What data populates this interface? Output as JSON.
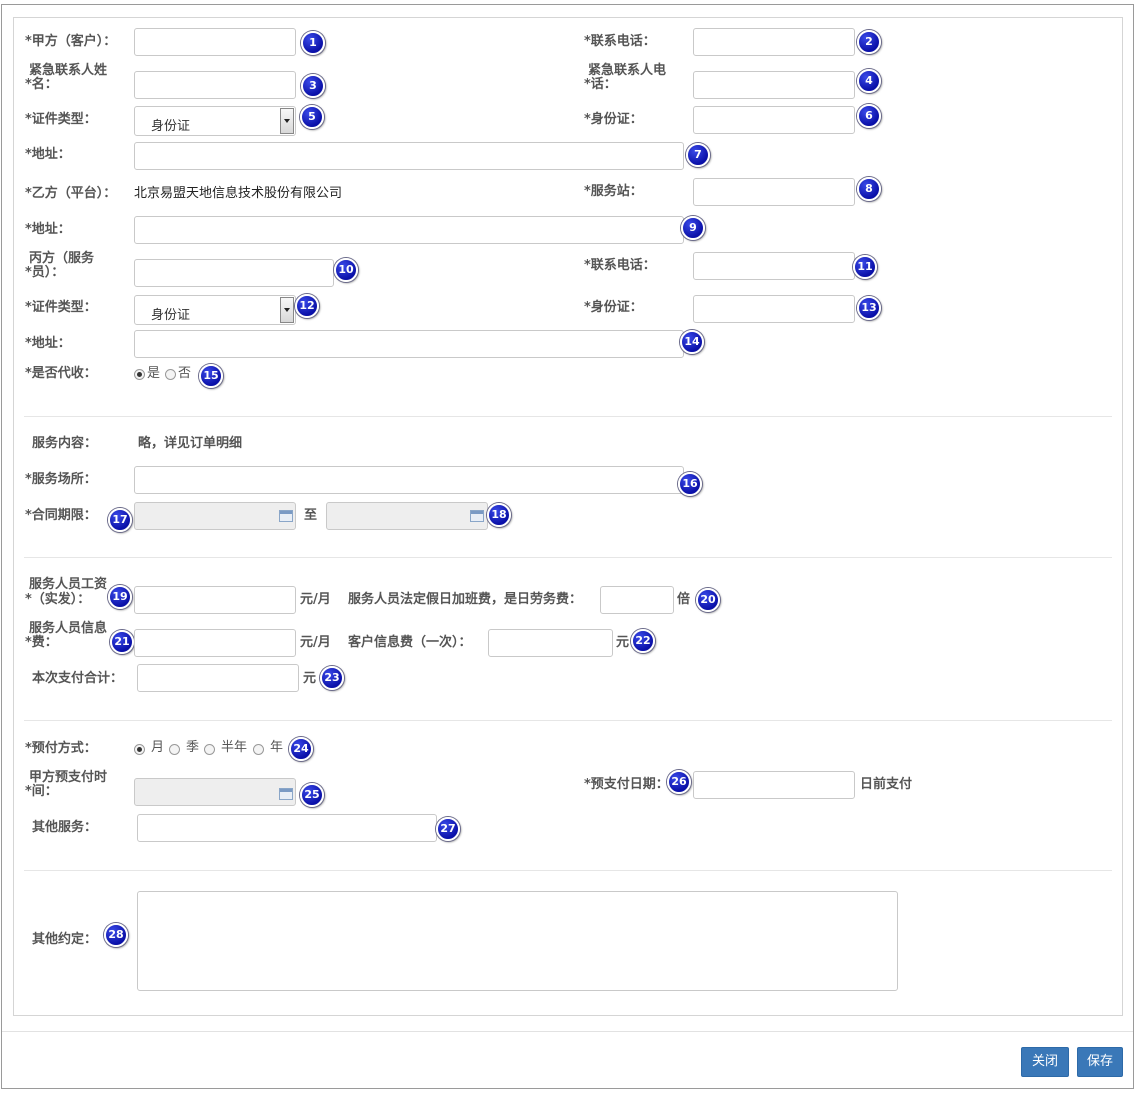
{
  "fields": {
    "party_a_label": "*甲方（客户）：",
    "phone1_label": "*联系电话：",
    "emerg_name_l1": "紧急联系人姓",
    "emerg_name_l2": "*名：",
    "emerg_phone_l1": "紧急联系人电",
    "emerg_phone_l2": "*话：",
    "idtype1_label": "*证件类型：",
    "idtype1_value": "身份证",
    "idcard1_label": "*身份证：",
    "addr1_label": "*地址：",
    "party_b_label": "*乙方（平台）：",
    "party_b_value": "北京易盟天地信息技术股份有限公司",
    "station_label": "*服务站：",
    "addr2_label": "*地址：",
    "party_c_l1": "丙方（服务",
    "party_c_l2": "*员）：",
    "phone2_label": "*联系电话：",
    "idtype2_label": "*证件类型：",
    "idtype2_value": "身份证",
    "idcard2_label": "*身份证：",
    "addr3_label": "*地址：",
    "collect_label": "*是否代收：",
    "collect_yes": "是",
    "collect_no": "否",
    "service_content_label": "服务内容：",
    "service_content_value": "略，详见订单明细",
    "service_place_label": "*服务场所：",
    "contract_label": "*合同期限：",
    "to_text": "至",
    "wage_l1": "服务人员工资",
    "wage_l2": "*（实发）：",
    "per_month_1": "元/月",
    "overtime_label": "服务人员法定假日加班费，是日劳务费：",
    "times_unit": "倍",
    "info_fee_l1": "服务人员信息",
    "info_fee_l2": "*费：",
    "per_month_2": "元/月",
    "client_fee_label": "客户信息费（一次）：",
    "yuan_1": "元",
    "total_label": "本次支付合计：",
    "yuan_2": "元",
    "prepay_label": "*预付方式：",
    "prepay_month": "月",
    "prepay_quarter": "季",
    "prepay_half": "半年",
    "prepay_year": "年",
    "prepay_time_l1": "甲方预支付时",
    "prepay_time_l2": "*间：",
    "prepay_date_label": "*预支付日期：",
    "before_pay": "日前支付",
    "other_service_label": "其他服务：",
    "other_agree_label": "其他约定："
  },
  "badges": [
    "1",
    "2",
    "3",
    "4",
    "5",
    "6",
    "7",
    "8",
    "9",
    "10",
    "11",
    "12",
    "13",
    "14",
    "15",
    "16",
    "17",
    "18",
    "19",
    "20",
    "21",
    "22",
    "23",
    "24",
    "25",
    "26",
    "27",
    "28"
  ],
  "buttons": {
    "close": "关闭",
    "save": "保存"
  },
  "colors": {
    "button": "#3a78b8",
    "badge": "#0a10a8",
    "disabled_input": "#eeeeee"
  }
}
